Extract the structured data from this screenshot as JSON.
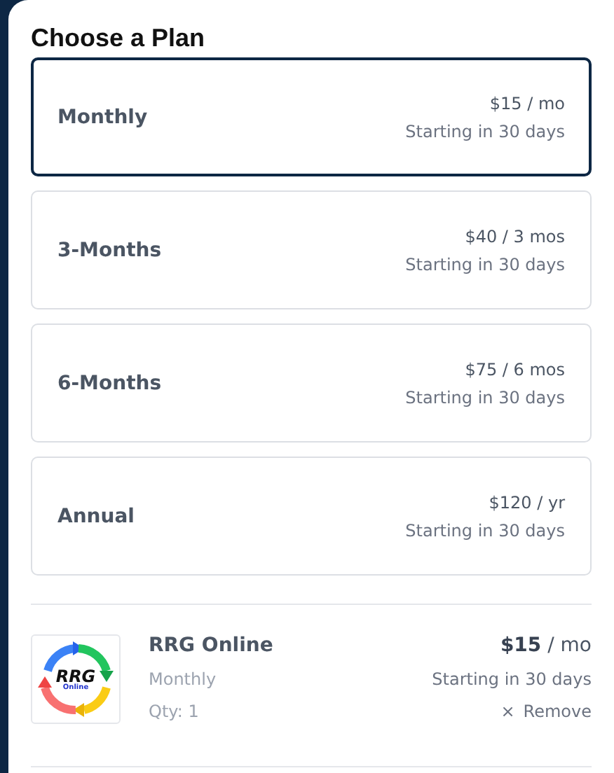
{
  "title": "Choose a Plan",
  "plans": [
    {
      "name": "Monthly",
      "price": "$15 / mo",
      "start": "Starting in 30 days",
      "selected": true
    },
    {
      "name": "3-Months",
      "price": "$40 / 3 mos",
      "start": "Starting in 30 days",
      "selected": false
    },
    {
      "name": "6-Months",
      "price": "$75 / 6 mos",
      "start": "Starting in 30 days",
      "selected": false
    },
    {
      "name": "Annual",
      "price": "$120 / yr",
      "start": "Starting in 30 days",
      "selected": false
    }
  ],
  "cart_item": {
    "logo": {
      "mark": "RRG",
      "sub": "Online"
    },
    "name": "RRG Online",
    "plan": "Monthly",
    "qty": "Qty: 1",
    "price": "**$15** / mo",
    "start": "Starting in 30 days",
    "remove": {
      "icon": "×",
      "label": "Remove"
    }
  }
}
